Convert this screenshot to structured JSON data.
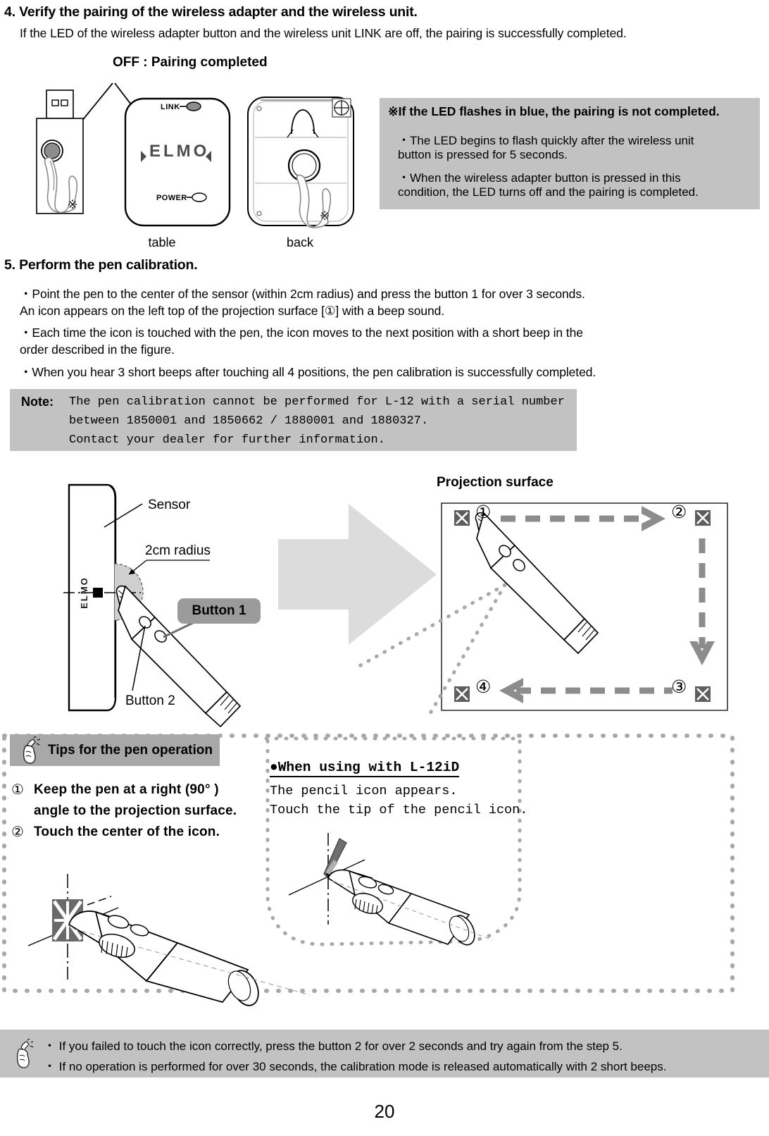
{
  "page": {
    "number": "20",
    "accent_gray": "#c2c2c2",
    "badge_gray": "#9b9b9b",
    "tips_header_gray": "#a8a8a8",
    "arrow_gray": "#d9d9d9",
    "dotted_gray": "#a0a0a0"
  },
  "step4": {
    "heading": "4. Verify the pairing of the wireless adapter and the wireless unit.",
    "intro": "If the LED of the wireless adapter button and the wireless unit LINK are off, the pairing is successfully completed.",
    "callout": "OFF : Pairing completed",
    "device_labels": {
      "link": "LINK",
      "power": "POWER",
      "brand": "ELMO"
    },
    "captions": {
      "table": "table",
      "back": "back"
    },
    "note_box": {
      "title": "※If the LED flashes in blue, the pairing is not completed.",
      "bullets": [
        [
          "・The LED begins to flash quickly after the wireless unit",
          "  button is pressed for 5 seconds."
        ],
        [
          "・When the wireless adapter button is pressed in this",
          "  condition, the LED turns off and the pairing is completed."
        ]
      ]
    }
  },
  "step5": {
    "heading": "5. Perform the pen calibration.",
    "bullets": [
      [
        "・Point the pen to the center of the sensor (within 2cm radius) and press the button 1 for over 3 seconds.",
        " An icon appears on the left top of the projection surface [①] with a beep sound."
      ],
      [
        "・Each time the icon is touched with the pen, the icon moves to the next position with a short beep in the",
        " order described in the figure."
      ],
      [
        "・When you hear 3 short beeps after touching all 4 positions, the pen calibration is successfully completed."
      ]
    ],
    "note": {
      "label": "Note:",
      "lines": [
        "The pen calibration cannot be performed for L-12 with a serial number",
        "between 1850001 and 1850662 / 1880001 and 1880327.",
        "Contact your dealer for further information."
      ]
    },
    "figure": {
      "sensor_label": "Sensor",
      "radius_label": "2cm radius",
      "button1_label": "Button 1",
      "button2_label": "Button 2",
      "brand_label": "ELMO",
      "projection_caption": "Projection surface",
      "order_numbers": [
        "①",
        "②",
        "③",
        "④"
      ]
    }
  },
  "tips": {
    "header_label": "Tips for the pen operation",
    "items": [
      {
        "num": "①",
        "lines": [
          "Keep the pen at a right (90°  )",
          "angle to the projection surface."
        ]
      },
      {
        "num": "②",
        "lines": [
          "Touch the center of the icon."
        ]
      }
    ],
    "l12id": {
      "title": "●When using with L-12iD",
      "lines": [
        "The pencil icon appears.",
        "Touch the tip of the pencil icon."
      ]
    }
  },
  "footer": {
    "bullets": [
      "・ If you failed to touch the icon correctly, press the button 2 for over 2 seconds and try again from the step 5.",
      "・ If no operation is performed for over 30 seconds, the calibration mode is released automatically with 2 short beeps."
    ]
  }
}
